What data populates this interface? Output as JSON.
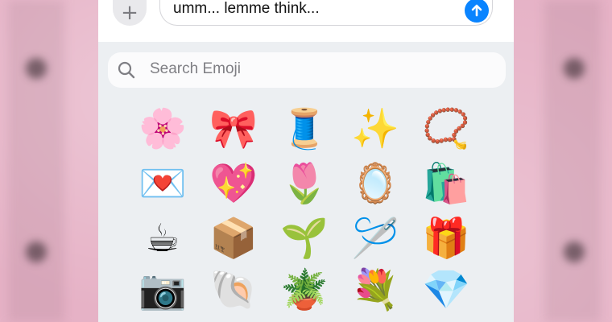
{
  "compose": {
    "plus_label": "+",
    "message_text": "umm... lemme think...",
    "send_icon": "arrow-up-icon",
    "accent": "#0a84ff"
  },
  "search": {
    "placeholder": "Search Emoji",
    "icon": "search-icon"
  },
  "emoji_grid": {
    "rows": [
      [
        {
          "name": "cherry-blossom",
          "glyph": "🌸"
        },
        {
          "name": "ribbon",
          "glyph": "🎀"
        },
        {
          "name": "thread-spool",
          "glyph": "🧵"
        },
        {
          "name": "sparkles",
          "glyph": "✨"
        },
        {
          "name": "prayer-beads",
          "glyph": "📿"
        }
      ],
      [
        {
          "name": "love-letter",
          "glyph": "💌"
        },
        {
          "name": "sparkling-heart",
          "glyph": "💖"
        },
        {
          "name": "tulip",
          "glyph": "🌷"
        },
        {
          "name": "mirror",
          "glyph": "🪞"
        },
        {
          "name": "shopping-bags",
          "glyph": "🛍️"
        }
      ],
      [
        {
          "name": "hot-beverage",
          "glyph": "☕"
        },
        {
          "name": "package",
          "glyph": "📦"
        },
        {
          "name": "seedling",
          "glyph": "🌱"
        },
        {
          "name": "sewing-needle",
          "glyph": "🪡"
        },
        {
          "name": "wrapped-gift",
          "glyph": "🎁"
        }
      ],
      [
        {
          "name": "camera",
          "glyph": "📷"
        },
        {
          "name": "spiral-shell",
          "glyph": "🐚"
        },
        {
          "name": "potted-plant",
          "glyph": "🪴"
        },
        {
          "name": "bouquet",
          "glyph": "💐"
        },
        {
          "name": "gem-stone",
          "glyph": "💎"
        }
      ]
    ]
  }
}
